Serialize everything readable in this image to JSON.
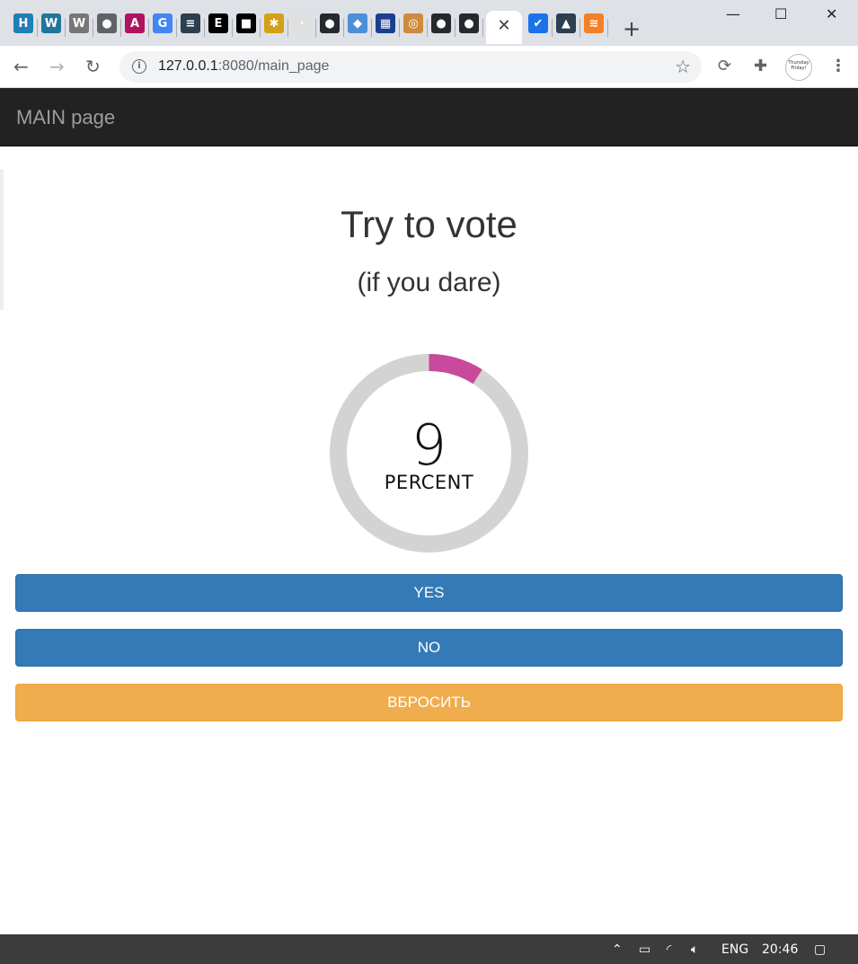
{
  "browser": {
    "tabs": [
      {
        "icon": "hackernoon-icon",
        "glyph": "H",
        "color": "#1f7fb6"
      },
      {
        "icon": "wordpress-icon",
        "glyph": "W",
        "color": "#21759b"
      },
      {
        "icon": "wordpress-icon",
        "glyph": "W",
        "color": "#777777"
      },
      {
        "icon": "globe-icon",
        "glyph": "●",
        "color": "#5f6368"
      },
      {
        "icon": "a-logo-icon",
        "glyph": "A",
        "color": "#b0135f"
      },
      {
        "icon": "google-icon",
        "glyph": "G",
        "color": "#4285f4"
      },
      {
        "icon": "tie-icon",
        "glyph": "≡",
        "color": "#2c3e50"
      },
      {
        "icon": "e-logo-icon",
        "glyph": "E",
        "color": "#000000"
      },
      {
        "icon": "square-logo-icon",
        "glyph": "■",
        "color": "#000000"
      },
      {
        "icon": "bee-icon",
        "glyph": "✱",
        "color": "#d4a017"
      },
      {
        "icon": "blank-page-icon",
        "glyph": "·",
        "color": "#e0e0e0"
      },
      {
        "icon": "github-icon",
        "glyph": "●",
        "color": "#24292e"
      },
      {
        "icon": "stack-icon",
        "glyph": "◆",
        "color": "#4a90d9"
      },
      {
        "icon": "grid-icon",
        "glyph": "▦",
        "color": "#1a3f8f"
      },
      {
        "icon": "donut-icon",
        "glyph": "◎",
        "color": "#d08a3c"
      },
      {
        "icon": "github-icon",
        "glyph": "●",
        "color": "#24292e"
      },
      {
        "icon": "github-icon",
        "glyph": "●",
        "color": "#24292e"
      }
    ],
    "active_tab_close": "✕",
    "tabs_after": [
      {
        "icon": "checkmark-icon",
        "glyph": "✔",
        "color": "#1a73e8"
      },
      {
        "icon": "graduation-cap-icon",
        "glyph": "▲",
        "color": "#2c3e50"
      },
      {
        "icon": "stackoverflow-icon",
        "glyph": "≋",
        "color": "#f48024"
      }
    ],
    "new_tab": "+",
    "window": {
      "minimize": "—",
      "maximize": "☐",
      "close": "✕"
    },
    "url_host": "127.0.0.1",
    "url_path": ":8080/main_page",
    "avatar_text": "Thursday Friday!"
  },
  "app": {
    "brand": "MAIN page",
    "title": "Try to vote",
    "subtitle": "(if you dare)",
    "gauge": {
      "value": 9,
      "value_text": "9",
      "unit": "PERCENT",
      "track_color": "#d3d3d3",
      "fill_color": "#c94a9c"
    },
    "buttons": {
      "yes": "YES",
      "no": "NO",
      "reset": "ВБРОСИТЬ"
    }
  },
  "taskbar": {
    "language": "ENG",
    "time": "20:46"
  }
}
